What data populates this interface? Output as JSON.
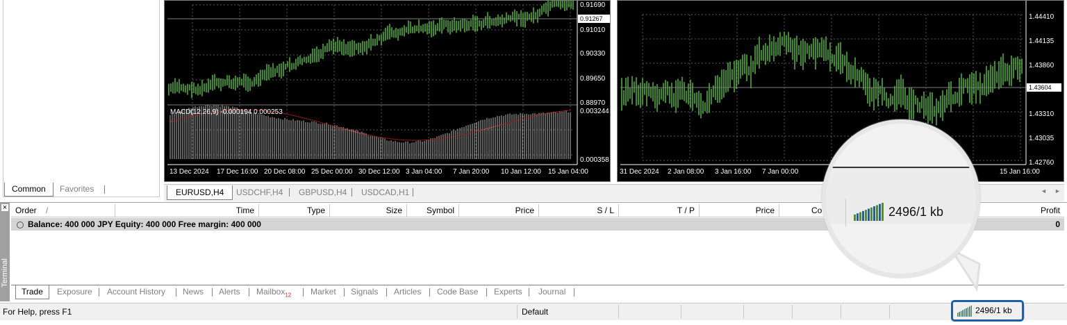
{
  "navigator": {
    "tabs": [
      {
        "label": "Common",
        "active": true
      },
      {
        "label": "Favorites",
        "active": false
      }
    ]
  },
  "chart_left": {
    "price_levels": [
      "0.91690",
      "0.91010",
      "0.90330",
      "0.89650",
      "0.88970"
    ],
    "current_price": "0.91267",
    "macd_label": "MACD(12,26,9) -0.000194 0.000253",
    "macd_levels": [
      "0.003244",
      "0.000358"
    ],
    "time_labels": [
      "13 Dec 2024",
      "17 Dec 16:00",
      "20 Dec 08:00",
      "25 Dec 00:00",
      "30 Dec 12:00",
      "3 Jan 04:00",
      "7 Jan 20:00",
      "10 Jan 12:00",
      "15 Jan 04:00"
    ]
  },
  "chart_right": {
    "price_levels": [
      "1.44410",
      "1.44135",
      "1.43860",
      "1.43310",
      "1.43035",
      "1.42760"
    ],
    "current_price": "1.43604",
    "time_labels": [
      "31 Dec 2024",
      "2 Jan 08:00",
      "3 Jan 16:00",
      "7 Jan 00:00",
      "15 Jan 16:00"
    ]
  },
  "chart_tabs": [
    {
      "label": "EURUSD,H4",
      "active": true
    },
    {
      "label": "USDCHF,H4",
      "active": false
    },
    {
      "label": "GBPUSD,H4",
      "active": false
    },
    {
      "label": "USDCAD,H1",
      "active": false
    }
  ],
  "terminal": {
    "side_label": "Terminal",
    "close_glyph": "×",
    "columns": {
      "order": "Order",
      "sort_glyph": "/",
      "time": "Time",
      "type": "Type",
      "size": "Size",
      "symbol": "Symbol",
      "price": "Price",
      "sl": "S / L",
      "tp": "T / P",
      "price2": "Price",
      "commission": "Co",
      "profit": "Profit"
    },
    "balance_text": "Balance: 400 000 JPY   Equity: 400 000   Free margin: 400 000",
    "profit_value": "0",
    "tabs": [
      {
        "label": "Trade",
        "active": true
      },
      {
        "label": "Exposure"
      },
      {
        "label": "Account History"
      },
      {
        "label": "News"
      },
      {
        "label": "Alerts"
      },
      {
        "label": "Mailbox",
        "badge": "12"
      },
      {
        "label": "Market"
      },
      {
        "label": "Signals"
      },
      {
        "label": "Articles"
      },
      {
        "label": "Code Base"
      },
      {
        "label": "Experts"
      },
      {
        "label": "Journal"
      }
    ]
  },
  "status_bar": {
    "help_text": "For Help, press F1",
    "profile": "Default",
    "traffic": "2496/1 kb"
  },
  "magnifier": {
    "traffic": "2496/1 kb"
  },
  "colors": {
    "candle": "#55c83a",
    "macd_signal": "#e02020",
    "highlight": "#1a5fa8"
  }
}
